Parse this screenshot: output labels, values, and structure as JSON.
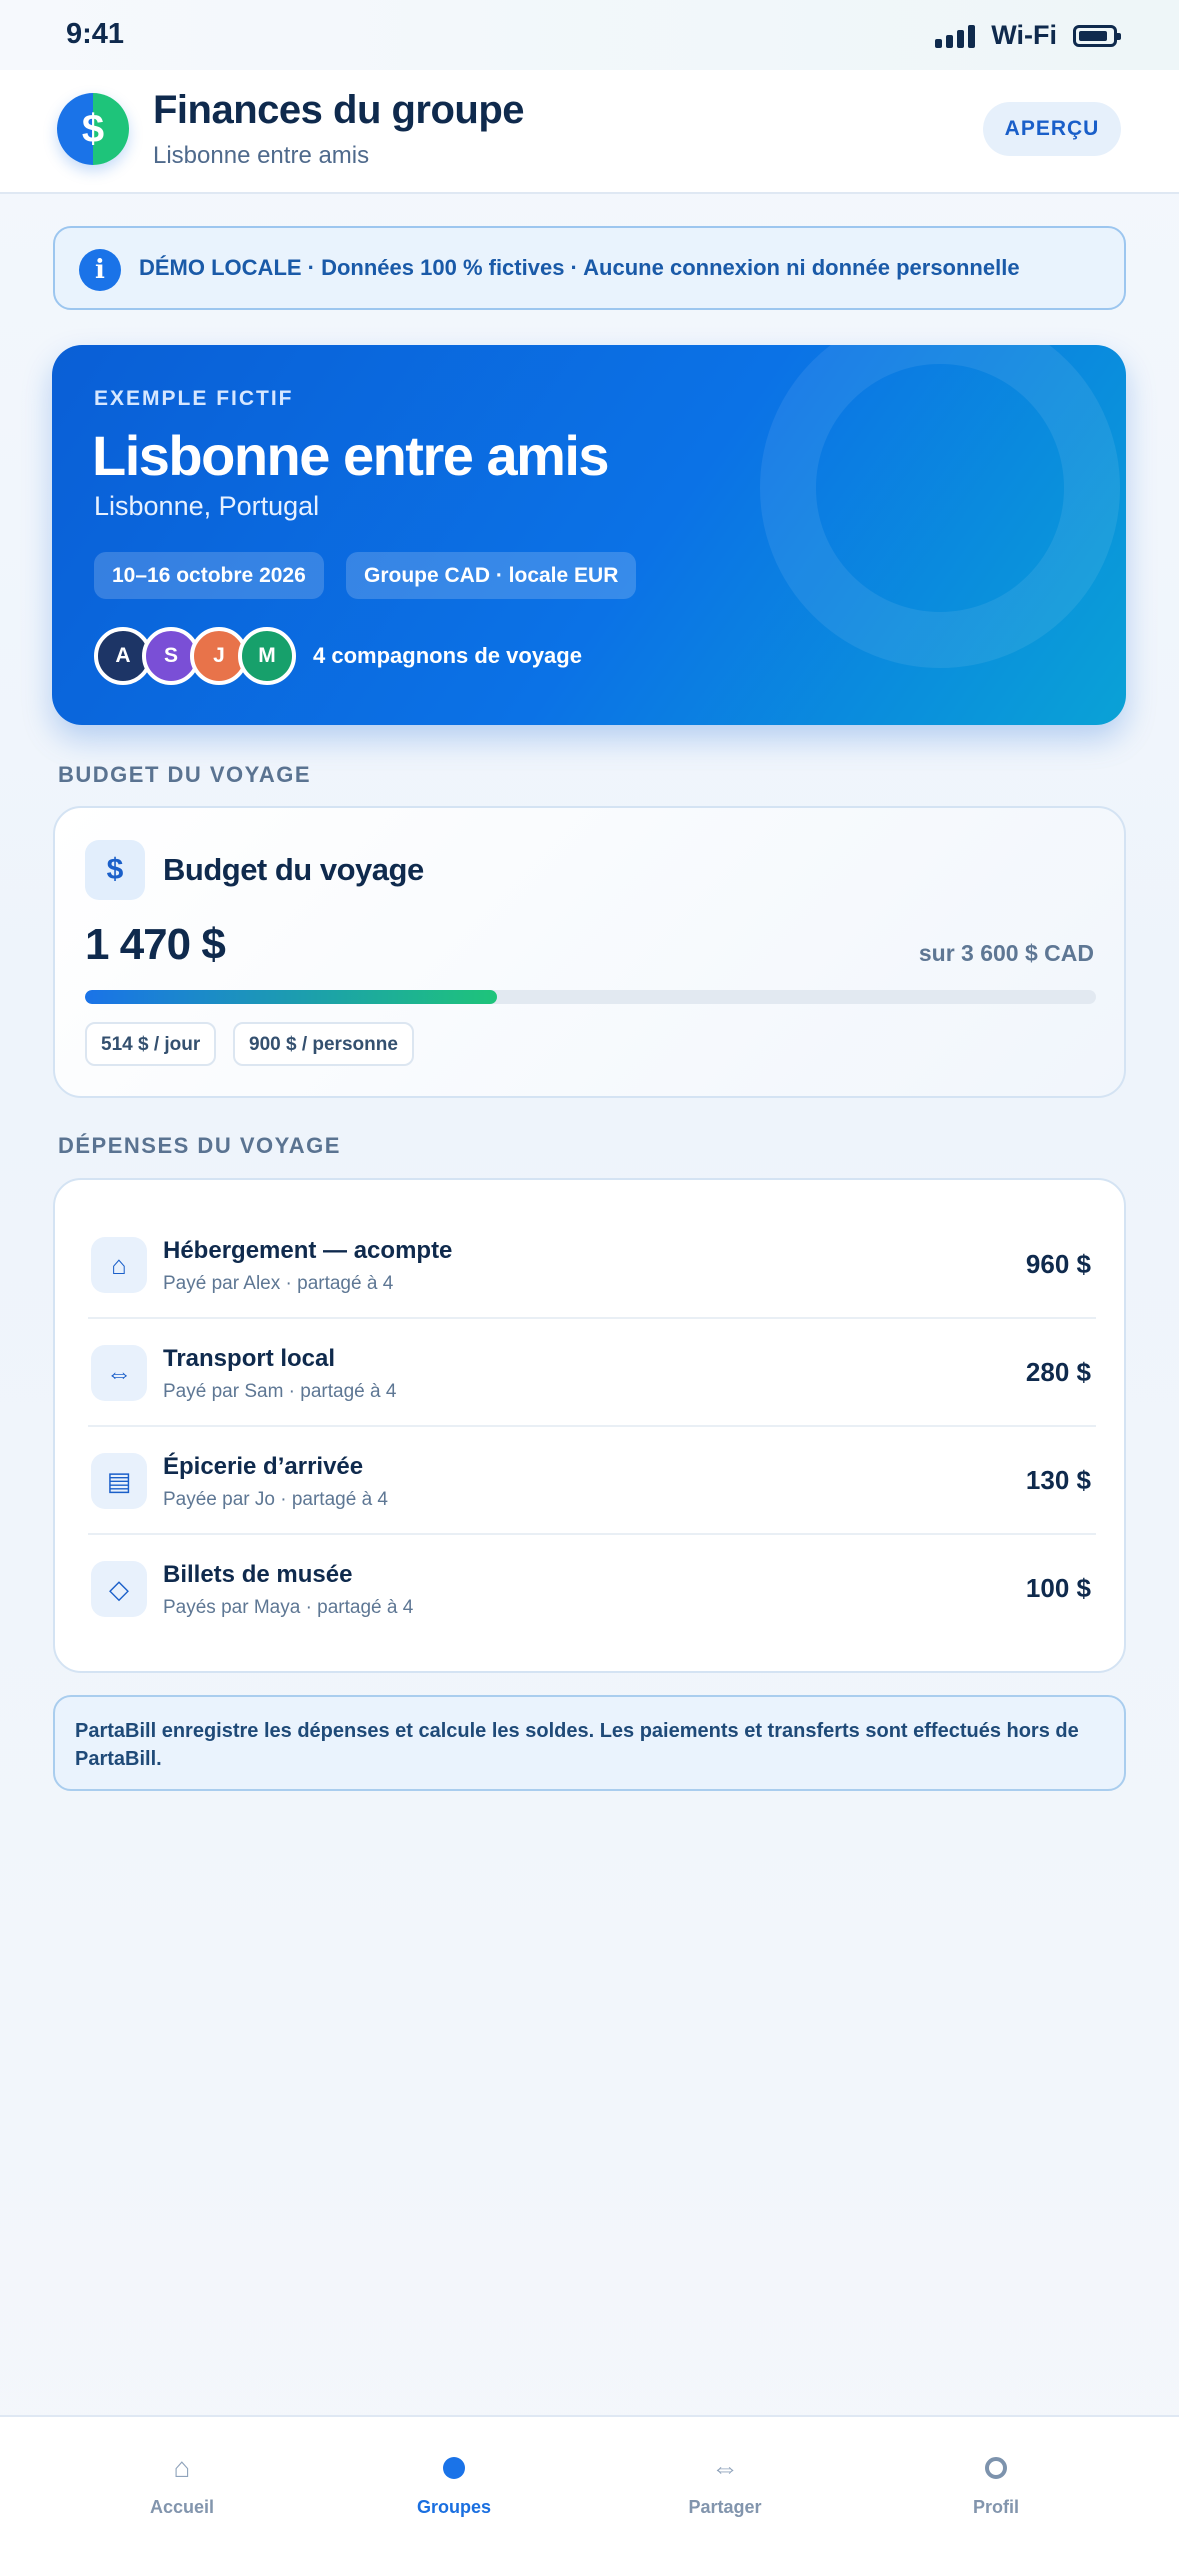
{
  "status_bar": {
    "time": "9:41",
    "wifi": "Wi-Fi"
  },
  "header": {
    "logo_glyph": "$",
    "title": "Finances du groupe",
    "subtitle": "Lisbonne entre amis",
    "action_label": "APERÇU"
  },
  "demo_banner": {
    "icon": "info-icon",
    "text": "DÉMO LOCALE · Données 100 % fictives · Aucune connexion ni donnée personnelle"
  },
  "trip": {
    "eyebrow": "EXEMPLE FICTIF",
    "title": "Lisbonne entre amis",
    "location": "Lisbonne, Portugal",
    "dates": "10–16 octobre 2026",
    "currency": "Groupe CAD · locale EUR",
    "members": [
      {
        "initial": "A",
        "color": "#1d3566"
      },
      {
        "initial": "S",
        "color": "#7a4fd6"
      },
      {
        "initial": "J",
        "color": "#e8734a"
      },
      {
        "initial": "M",
        "color": "#17a06b"
      }
    ],
    "companions": "4 compagnons de voyage"
  },
  "budget_section": {
    "heading": "BUDGET DU VOYAGE",
    "icon_glyph": "$",
    "title": "Budget du voyage",
    "spent": "1 470 $",
    "total": "sur 3 600 $ CAD",
    "progress_percent": 40.8,
    "per_day": "514 $ / jour",
    "per_person": "900 $ / personne"
  },
  "expenses_section": {
    "heading": "DÉPENSES DU VOYAGE",
    "items": [
      {
        "icon": "home-icon",
        "glyph": "⌂",
        "name": "Hébergement — acompte",
        "meta": "Payé par Alex · partagé à 4",
        "amount": "960 $"
      },
      {
        "icon": "transfer-icon",
        "glyph": "⇔",
        "name": "Transport local",
        "meta": "Payé par Sam · partagé à 4",
        "amount": "280 $"
      },
      {
        "icon": "grocery-icon",
        "glyph": "▤",
        "name": "Épicerie d’arrivée",
        "meta": "Payée par Jo · partagé à 4",
        "amount": "130 $"
      },
      {
        "icon": "ticket-icon",
        "glyph": "◇",
        "name": "Billets de musée",
        "meta": "Payés par Maya · partagé à 4",
        "amount": "100 $"
      }
    ]
  },
  "disclaimer": "PartaBill enregistre les dépenses et calcule les soldes. Les paiements et transferts sont effectués hors de PartaBill.",
  "tab_bar": {
    "active": "Groupes",
    "tabs": [
      {
        "label": "Accueil",
        "icon": "home-icon",
        "glyph": "⌂"
      },
      {
        "label": "Groupes",
        "icon": "groups-dot-icon",
        "glyph": ""
      },
      {
        "label": "Partager",
        "icon": "share-arrows-icon",
        "glyph": "⇔"
      },
      {
        "label": "Profil",
        "icon": "profile-ring-icon",
        "glyph": ""
      }
    ]
  },
  "colors": {
    "brand_blue": "#1a73e8",
    "brand_green": "#1ec47a",
    "text_dark": "#0f2a4d"
  }
}
